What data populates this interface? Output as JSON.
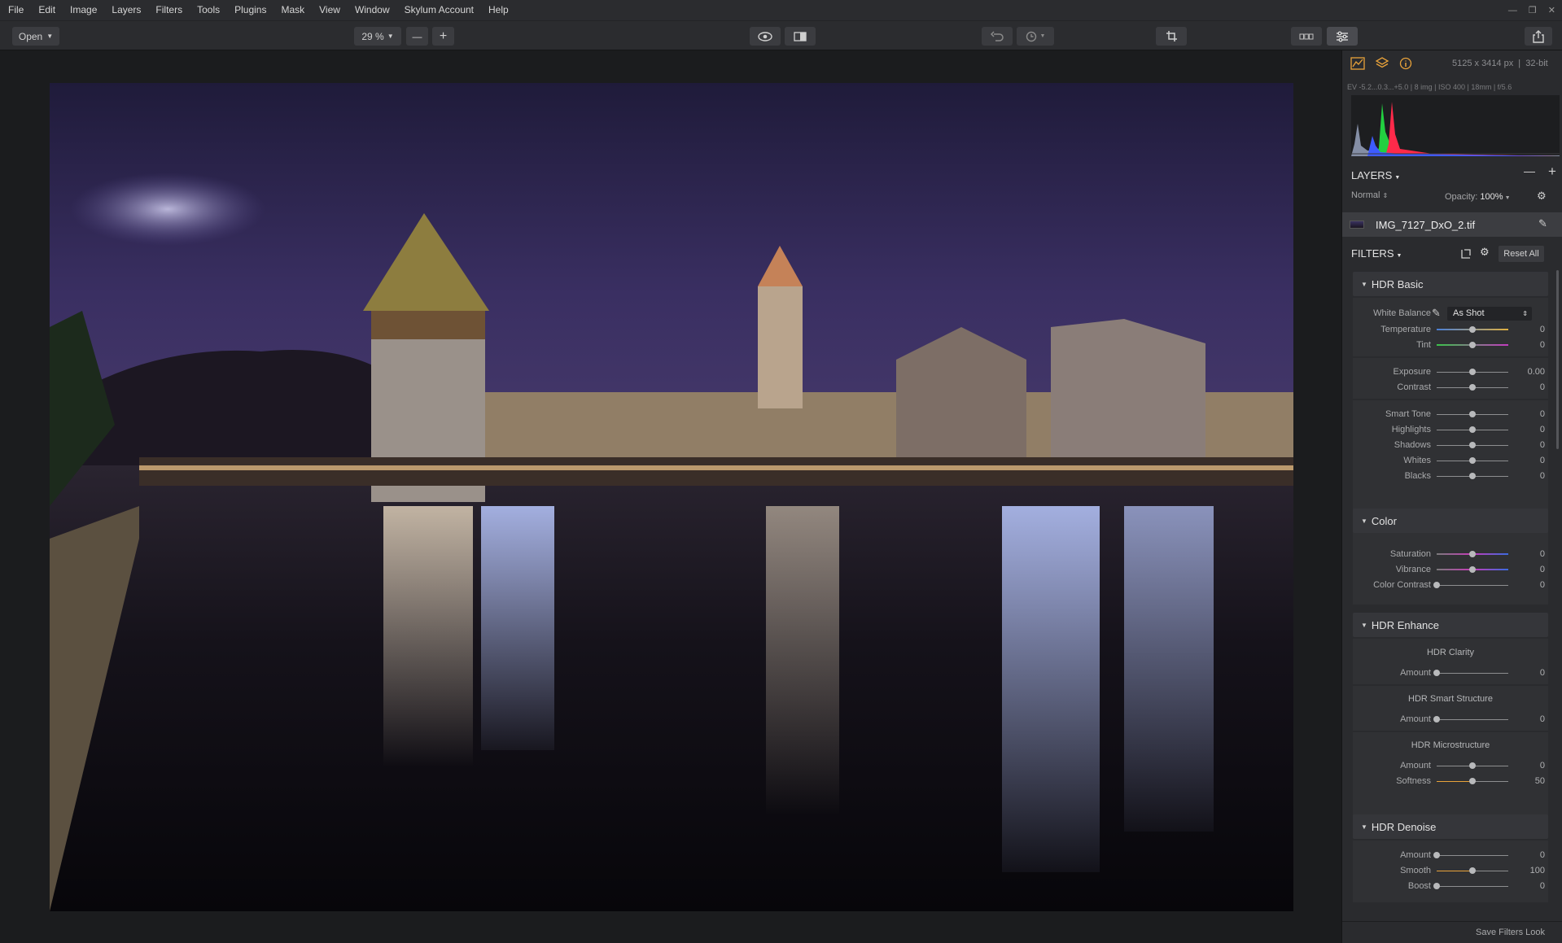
{
  "menu": [
    "File",
    "Edit",
    "Image",
    "Layers",
    "Filters",
    "Tools",
    "Plugins",
    "Mask",
    "View",
    "Window",
    "Skylum Account",
    "Help"
  ],
  "toolbar": {
    "open_label": "Open",
    "zoom": "29 %"
  },
  "info": {
    "dimensions": "5125 x 3414 px",
    "bitdepth": "32-bit",
    "exif": "EV -5.2...0.3...+5.0  |  8 img  |  ISO 400  |  18mm  |  f/5.6"
  },
  "layers": {
    "title": "LAYERS",
    "blend_mode": "Normal",
    "opacity_label": "Opacity:",
    "opacity_value": "100%",
    "layer_name": "IMG_7127_DxO_2.tif"
  },
  "filters": {
    "title": "FILTERS",
    "reset_label": "Reset All",
    "save_label": "Save Filters Look"
  },
  "hdr_basic": {
    "title": "HDR Basic",
    "wb_label": "White Balance",
    "wb_value": "As Shot",
    "temperature": {
      "label": "Temperature",
      "value": "0",
      "level": 0.5
    },
    "tint": {
      "label": "Tint",
      "value": "0",
      "level": 0.5
    },
    "exposure": {
      "label": "Exposure",
      "value": "0.00",
      "level": 0.5
    },
    "contrast": {
      "label": "Contrast",
      "value": "0",
      "level": 0.5
    },
    "smart_tone": {
      "label": "Smart Tone",
      "value": "0",
      "level": 0.5
    },
    "highlights": {
      "label": "Highlights",
      "value": "0",
      "level": 0.5
    },
    "shadows": {
      "label": "Shadows",
      "value": "0",
      "level": 0.5
    },
    "whites": {
      "label": "Whites",
      "value": "0",
      "level": 0.5
    },
    "blacks": {
      "label": "Blacks",
      "value": "0",
      "level": 0.5
    }
  },
  "color": {
    "title": "Color",
    "saturation": {
      "label": "Saturation",
      "value": "0",
      "level": 0.5
    },
    "vibrance": {
      "label": "Vibrance",
      "value": "0",
      "level": 0.5
    },
    "color_contrast": {
      "label": "Color Contrast",
      "value": "0",
      "level": 0.0
    }
  },
  "hdr_enhance": {
    "title": "HDR Enhance",
    "clarity_title": "HDR Clarity",
    "clarity_amount": {
      "label": "Amount",
      "value": "0",
      "level": 0.0
    },
    "structure_title": "HDR Smart Structure",
    "structure_amount": {
      "label": "Amount",
      "value": "0",
      "level": 0.0
    },
    "micro_title": "HDR Microstructure",
    "micro_amount": {
      "label": "Amount",
      "value": "0",
      "level": 0.5
    },
    "micro_softness": {
      "label": "Softness",
      "value": "50",
      "level": 0.5
    }
  },
  "hdr_denoise": {
    "title": "HDR Denoise",
    "amount": {
      "label": "Amount",
      "value": "0",
      "level": 0.0
    },
    "smooth": {
      "label": "Smooth",
      "value": "100",
      "level": 0.5
    },
    "boost": {
      "label": "Boost",
      "value": "0",
      "level": 0.0
    }
  },
  "colors": {
    "accent": "#e8a23a",
    "panel": "#2a2b2e",
    "header": "#35363a"
  }
}
